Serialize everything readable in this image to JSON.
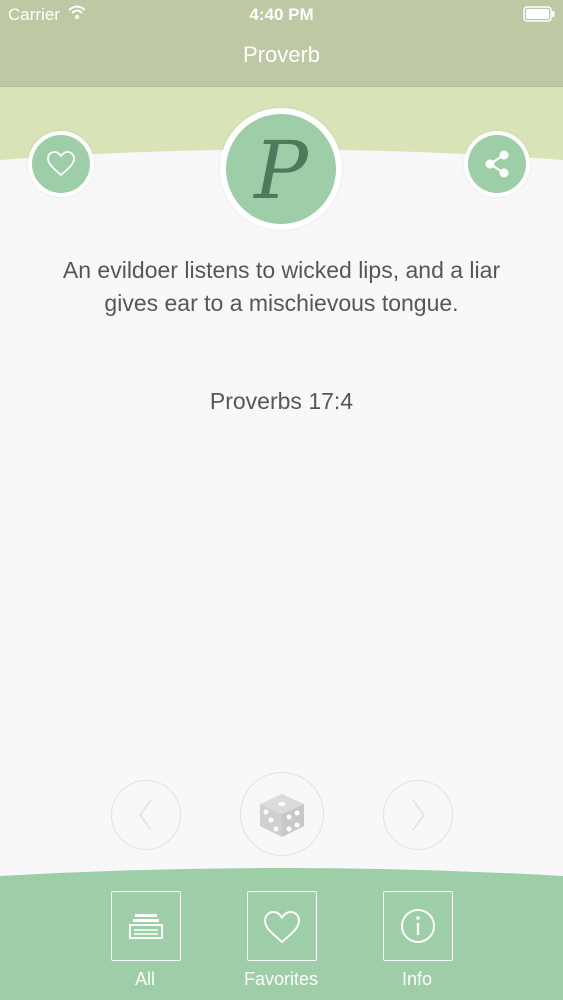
{
  "status_bar": {
    "carrier": "Carrier",
    "time": "4:40 PM",
    "wifi_icon": "wifi-icon",
    "battery_icon": "battery-icon"
  },
  "nav": {
    "title": "Proverb"
  },
  "header": {
    "logo_letter": "P",
    "favorite_icon": "heart-icon",
    "share_icon": "share-icon"
  },
  "proverb": {
    "text": "An evildoer listens to wicked lips, and a liar gives ear to a mischievous tongue.",
    "reference": "Proverbs 17:4"
  },
  "controls": {
    "prev_icon": "chevron-left-icon",
    "random_icon": "dice-icon",
    "next_icon": "chevron-right-icon"
  },
  "tabs": [
    {
      "label": "All",
      "icon": "tray-icon"
    },
    {
      "label": "Favorites",
      "icon": "heart-icon"
    },
    {
      "label": "Info",
      "icon": "info-icon"
    }
  ],
  "colors": {
    "nav_bar": "#bec8a4",
    "header_band": "#d8e4b8",
    "accent_green": "#9dcea7",
    "logo_text": "#4e7a5c",
    "body_text": "#565656",
    "background": "#f8f8f9"
  }
}
